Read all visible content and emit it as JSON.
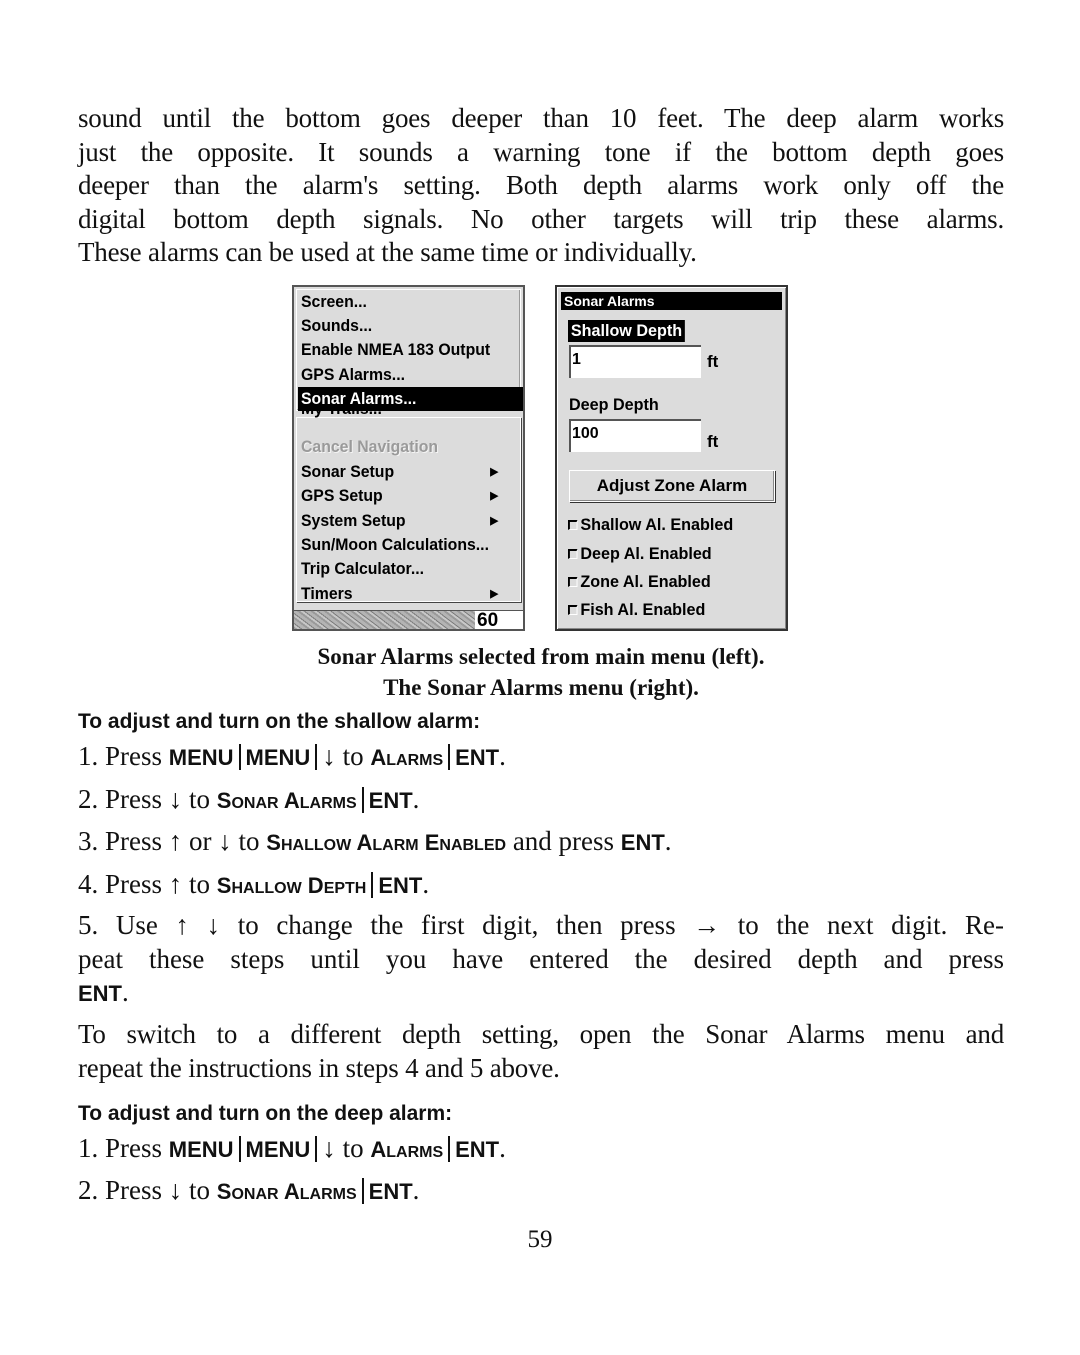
{
  "intro_paragraph": {
    "lines": [
      "sound until the bottom goes deeper than 10 feet. The deep alarm works",
      "just the opposite. It sounds a warning tone if the bottom depth goes",
      "deeper than the alarm's setting. Both depth alarms work only off the",
      "digital bottom depth signals. No other targets will trip these alarms.",
      "These alarms can be used at the same time or individually."
    ]
  },
  "main_menu": {
    "items": [
      {
        "label": "Screen...",
        "state": "normal"
      },
      {
        "label": "Sounds...",
        "state": "normal"
      },
      {
        "label": "Enable NMEA 183 Output",
        "state": "normal"
      },
      {
        "label": "GPS Alarms...",
        "state": "normal"
      },
      {
        "label": "Sonar Alarms...",
        "state": "selected"
      },
      {
        "label": "My Trails...",
        "state": "normal"
      },
      {
        "label": "Cancel Navigation",
        "state": "disabled"
      },
      {
        "label": "Sonar Setup",
        "state": "submenu"
      },
      {
        "label": "GPS Setup",
        "state": "submenu"
      },
      {
        "label": "System Setup",
        "state": "submenu"
      },
      {
        "label": "Sun/Moon Calculations...",
        "state": "normal"
      },
      {
        "label": "Trip Calculator...",
        "state": "normal"
      },
      {
        "label": "Timers",
        "state": "submenu"
      }
    ],
    "submenu_arrow": "▶",
    "depth_readout": "60"
  },
  "sonar_alarms_menu": {
    "title": "Sonar Alarms",
    "shallow_label": "Shallow Depth",
    "shallow_value": "1",
    "shallow_unit": "ft",
    "deep_label": "Deep Depth",
    "deep_value": "100",
    "deep_unit": "ft",
    "zone_button": "Adjust Zone Alarm",
    "checkboxes": [
      {
        "label": "Shallow Al. Enabled",
        "checked": false
      },
      {
        "label": "Deep Al. Enabled",
        "checked": false
      },
      {
        "label": "Zone Al. Enabled",
        "checked": false
      },
      {
        "label": "Fish Al. Enabled",
        "checked": false
      }
    ]
  },
  "caption": {
    "line1": "Sonar Alarms selected from main menu (left).",
    "line2": "The Sonar Alarms menu (right)."
  },
  "shallow_section": {
    "heading": "To adjust and turn on the shallow alarm:",
    "steps": {
      "s1": {
        "num": "1. Press",
        "k1": "MENU",
        "k2": "MENU",
        "arrow": "↓",
        "to": "to",
        "t_cap": "A",
        "t_rest": "LARMS",
        "ent": "ENT",
        "dot": "."
      },
      "s2": {
        "num": "2. Press",
        "arrow": "↓",
        "to": "to",
        "t1_cap": "S",
        "t1_rest": "ONAR",
        "t2_cap": "A",
        "t2_rest": "LARMS",
        "ent": "ENT",
        "dot": "."
      },
      "s3": {
        "num": "3. Press",
        "up": "↑",
        "or": "or",
        "down": "↓",
        "to": "to",
        "t1_cap": "S",
        "t1_rest": "HALLOW",
        "t2_cap": "A",
        "t2_rest": "LARM",
        "t3_cap": "E",
        "t3_rest": "NABLED",
        "and_press": "and press",
        "ent": "ENT",
        "dot": "."
      },
      "s4": {
        "num": "4. Press",
        "up": "↑",
        "to": "to",
        "t1_cap": "S",
        "t1_rest": "HALLOW",
        "t2_cap": "D",
        "t2_rest": "EPTH",
        "ent": "ENT",
        "dot": "."
      },
      "s5": {
        "line1": "5. Use ↑ ↓ to change the first digit, then press → to the next digit. Re-",
        "line2": "peat these steps until you have entered the desired depth and press",
        "ent": "ENT",
        "dot": "."
      }
    }
  },
  "switch_paragraph": {
    "lines": [
      "To switch to a different depth setting, open the Sonar Alarms menu and",
      "repeat the instructions in steps 4 and 5 above."
    ]
  },
  "deep_section": {
    "heading": "To adjust and turn on the deep alarm:",
    "steps": {
      "s1": {
        "num": "1. Press",
        "k1": "MENU",
        "k2": "MENU",
        "arrow": "↓",
        "to": "to",
        "t_cap": "A",
        "t_rest": "LARMS",
        "ent": "ENT",
        "dot": "."
      },
      "s2": {
        "num": "2. Press",
        "arrow": "↓",
        "to": "to",
        "t1_cap": "S",
        "t1_rest": "ONAR",
        "t2_cap": "A",
        "t2_rest": "LARMS",
        "ent": "ENT",
        "dot": "."
      }
    }
  },
  "page_number": "59"
}
